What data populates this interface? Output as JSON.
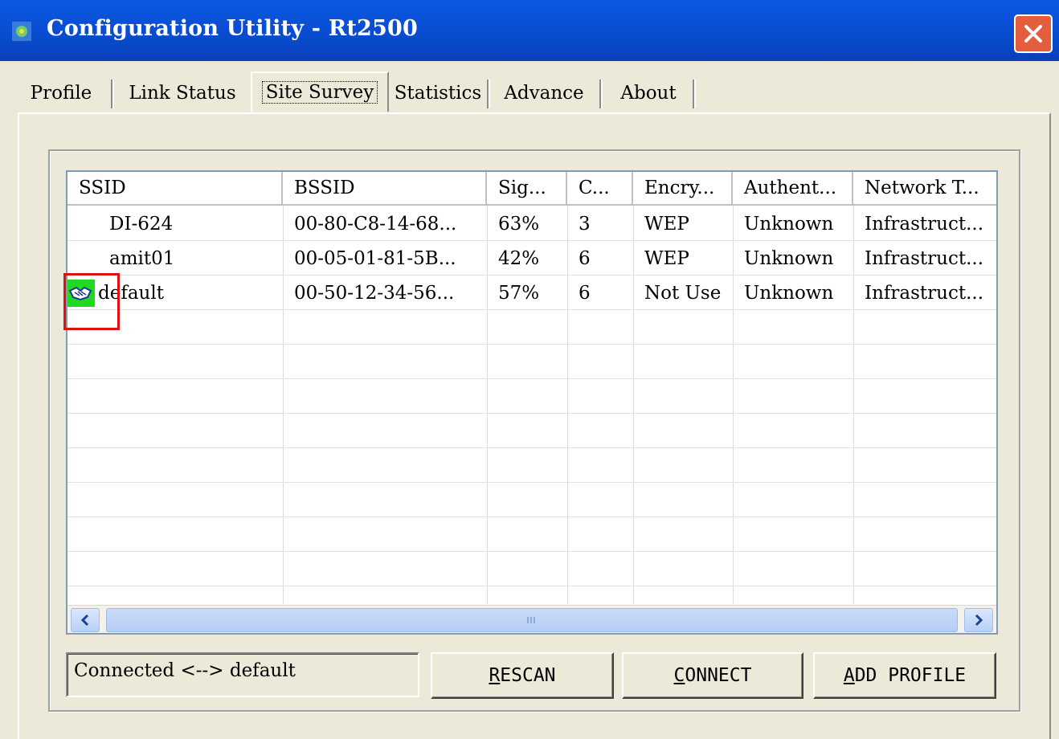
{
  "window": {
    "title": "Configuration Utility - Rt2500",
    "icon": "app-icon",
    "close_icon": "close-icon"
  },
  "tabs": [
    {
      "label": "Profile",
      "active": false
    },
    {
      "label": "Link Status",
      "active": false
    },
    {
      "label": "Site Survey",
      "active": true
    },
    {
      "label": "Statistics",
      "active": false
    },
    {
      "label": "Advance",
      "active": false
    },
    {
      "label": "About",
      "active": false
    }
  ],
  "table": {
    "columns": [
      "SSID",
      "BSSID",
      "Sig...",
      "C...",
      "Encry...",
      "Authent...",
      "Network T..."
    ],
    "rows": [
      {
        "ssid": "DI-624",
        "bssid": "00-80-C8-14-68...",
        "signal": "63%",
        "channel": "3",
        "encryption": "WEP",
        "auth": "Unknown",
        "network_type": "Infrastruct...",
        "icon": ""
      },
      {
        "ssid": "amit01",
        "bssid": "00-05-01-81-5B...",
        "signal": "42%",
        "channel": "6",
        "encryption": "WEP",
        "auth": "Unknown",
        "network_type": "Infrastruct...",
        "icon": ""
      },
      {
        "ssid": "default",
        "bssid": "00-50-12-34-56...",
        "signal": "57%",
        "channel": "6",
        "encryption": "Not Use",
        "auth": "Unknown",
        "network_type": "Infrastruct...",
        "icon": "connected-handshake-icon"
      }
    ]
  },
  "status": {
    "text": "Connected <--> default"
  },
  "buttons": {
    "rescan_rest": "ESCAN",
    "rescan_key": "R",
    "connect_rest": "ONNECT",
    "connect_key": "C",
    "add_key": "A",
    "add_rest": "DD PROFILE"
  },
  "colors": {
    "titlebar": "#0a4fd6",
    "background": "#ece9d8",
    "connected_icon_bg": "#22d922",
    "highlight_box": "#e01010"
  }
}
